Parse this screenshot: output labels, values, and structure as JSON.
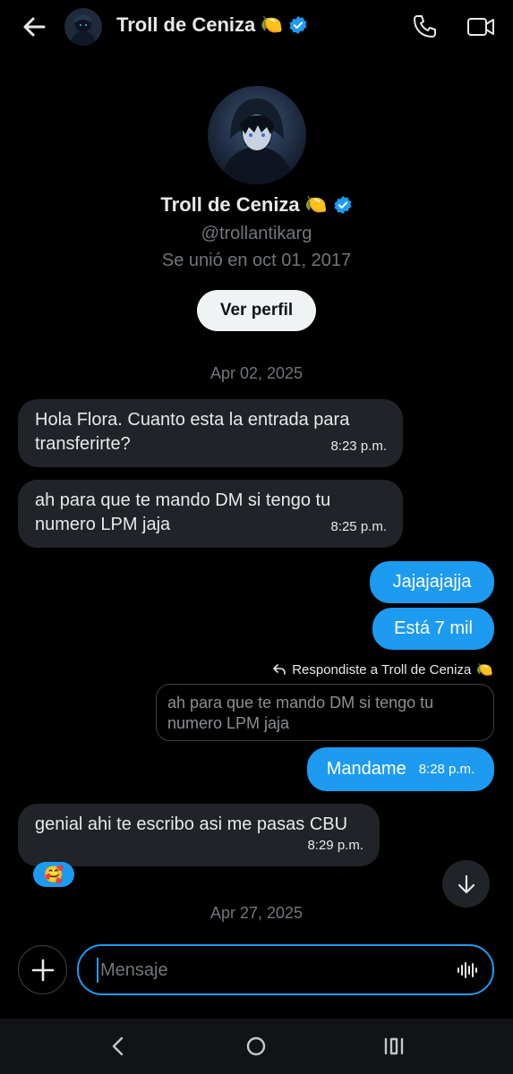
{
  "header": {
    "title": "Troll de Ceniza",
    "lemon": "🍋",
    "icons": [
      "back-arrow-icon",
      "avatar",
      "verified-badge-icon",
      "phone-icon",
      "video-icon"
    ]
  },
  "profile": {
    "name": "Troll de Ceniza",
    "lemon": "🍋",
    "handle": "@trollantikarg",
    "joined": "Se unió en oct 01, 2017",
    "view_profile_label": "Ver perfil"
  },
  "messages": {
    "date1": "Apr 02, 2025",
    "in1": {
      "text": "Hola Flora. Cuanto esta la entrada para transferirte?",
      "time": "8:23 p.m."
    },
    "in2": {
      "text": "ah para que te mando DM si tengo tu numero LPM jaja",
      "time": "8:25 p.m."
    },
    "out1": {
      "text": "Jajajajajja"
    },
    "out2": {
      "text": "Está 7 mil"
    },
    "reply_note": "Respondiste a Troll de Ceniza",
    "reply_note_lemon": "🍋",
    "quote": "ah para que te mando DM si tengo tu numero LPM jaja",
    "out3": {
      "text": "Mandame",
      "time": "8:28 p.m."
    },
    "in3": {
      "text": "genial ahi te escribo asi me pasas CBU",
      "time": "8:29 p.m."
    },
    "reaction": "🥰",
    "date2": "Apr 27, 2025"
  },
  "composer": {
    "placeholder": "Mensaje"
  },
  "colors": {
    "accent": "#1d9bf0",
    "background": "#000000",
    "incoming_bubble": "#202327",
    "muted_text": "#71767b"
  }
}
